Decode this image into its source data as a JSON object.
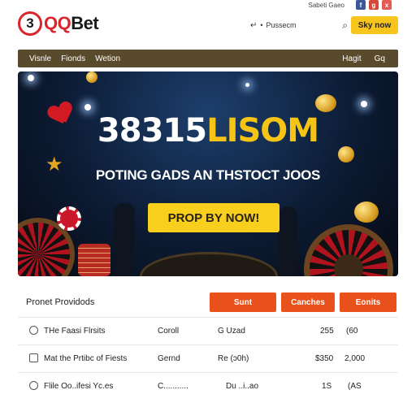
{
  "brand": {
    "badge": "3",
    "name_red": "QQ",
    "name_dark": "Bet"
  },
  "top_util": {
    "links": "Sabeti Gaeo",
    "social": [
      "f",
      "g",
      "x"
    ]
  },
  "search": {
    "clock": "↵",
    "dot": "•",
    "placeholder": "Pussecm"
  },
  "top_cta": "Sky now",
  "nav": {
    "left": [
      "Visnle",
      "Fionds",
      "Wetion"
    ],
    "right": [
      "Hagit",
      "Gq"
    ]
  },
  "hero": {
    "title_white": "38315",
    "title_yellow": "LISOM",
    "subtitle": "POTING GADS AN THSTOCT JOOS",
    "cta": "PROP BY NOW!"
  },
  "panel": {
    "title": "Pronet Providods",
    "columns": [
      "Sunt",
      "Canches",
      "Eonits"
    ],
    "rows": [
      {
        "icon": "check-circle-icon",
        "name": "THe Faasi Flrsits",
        "type": "Coroll",
        "mid": "G Uzad",
        "v1": "255",
        "v2": "(60"
      },
      {
        "icon": "box-icon",
        "name": "Mat the Prtibc of Fiests",
        "type": "Gernd",
        "mid": "Re (ɔ0h)",
        "v1": "$350",
        "v2": "2,000"
      },
      {
        "icon": "clock-circle-icon",
        "name": "Flile Oo..ifesi Yc.es",
        "type": "C...........",
        "mid": "Du ..i..ao",
        "v1": "1S",
        "v2": "(AS"
      }
    ]
  },
  "colors": {
    "accent_orange": "#e8501c",
    "cta_yellow": "#f7c51b",
    "nav_brown": "#5a4a2c",
    "brand_red": "#d8262c"
  }
}
